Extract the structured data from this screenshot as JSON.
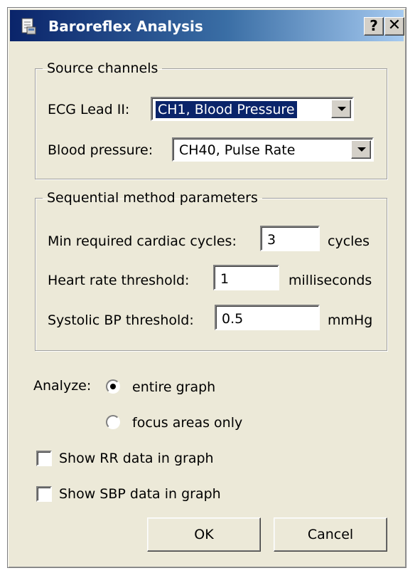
{
  "window": {
    "title": "Baroreflex Analysis",
    "help_label": "?",
    "close_label": "✕"
  },
  "source_channels": {
    "legend": "Source channels",
    "ecg_label": "ECG Lead II:",
    "ecg_value": "CH1, Blood Pressure",
    "bp_label": "Blood pressure:",
    "bp_value": "CH40, Pulse Rate"
  },
  "sequential": {
    "legend": "Sequential method parameters",
    "min_cycles_label": "Min required cardiac cycles:",
    "min_cycles_value": "3",
    "min_cycles_unit": "cycles",
    "hr_threshold_label": "Heart rate threshold:",
    "hr_threshold_value": "1",
    "hr_threshold_unit": "milliseconds",
    "sbp_threshold_label": "Systolic BP threshold:",
    "sbp_threshold_value": "0.5",
    "sbp_threshold_unit": "mmHg"
  },
  "analyze": {
    "label": "Analyze:",
    "options": [
      {
        "label": "entire graph",
        "selected": true
      },
      {
        "label": "focus areas only",
        "selected": false
      }
    ]
  },
  "checkboxes": [
    {
      "label": "Show RR data in graph",
      "checked": false
    },
    {
      "label": "Show SBP data in graph",
      "checked": false
    }
  ],
  "buttons": {
    "ok": "OK",
    "cancel": "Cancel"
  },
  "colors": {
    "title_gradient_start": "#0a246a",
    "title_gradient_end": "#a6caf0",
    "face": "#ece9d8",
    "selection": "#0a246a"
  }
}
